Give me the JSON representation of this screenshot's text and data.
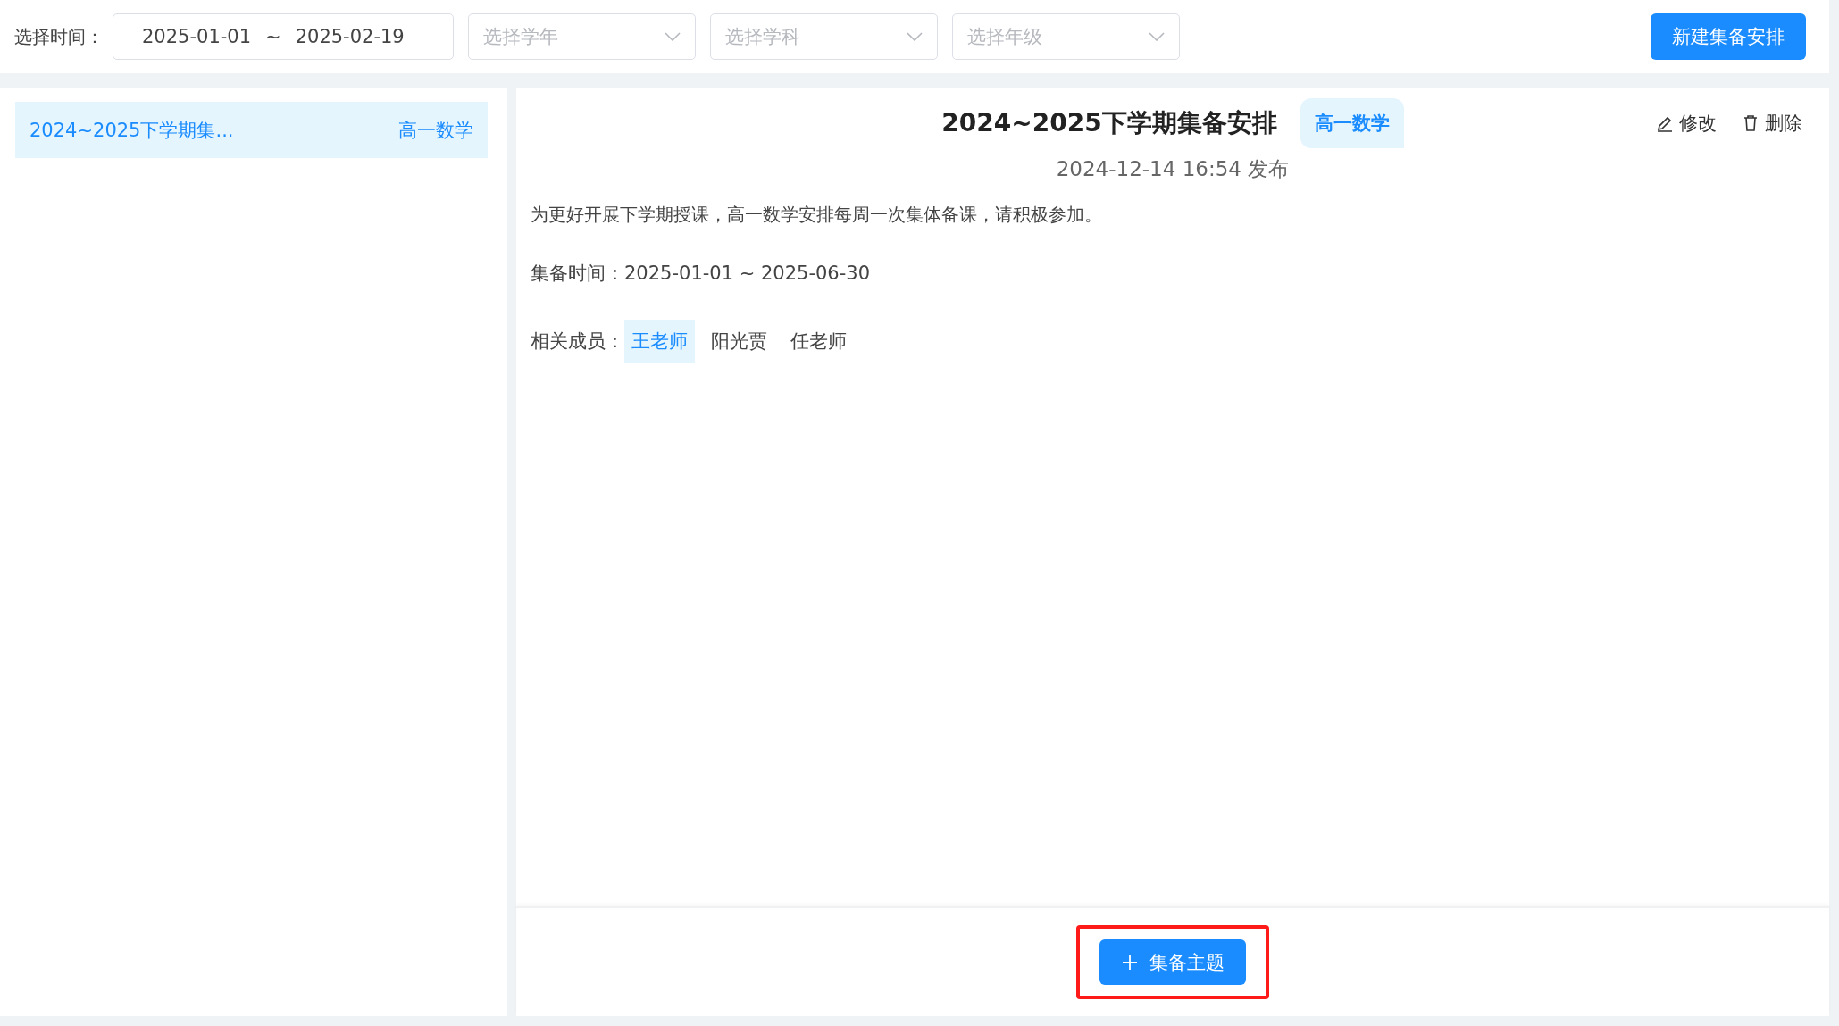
{
  "filter_bar": {
    "time_label": "选择时间：",
    "date_start": "2025-01-01",
    "date_separator": "~",
    "date_end": "2025-02-19",
    "selects": [
      {
        "placeholder": "选择学年"
      },
      {
        "placeholder": "选择学科"
      },
      {
        "placeholder": "选择年级"
      }
    ],
    "new_button": "新建集备安排"
  },
  "list": [
    {
      "title": "2024~2025下学期集...",
      "tag": "高一数学",
      "selected": true
    }
  ],
  "detail": {
    "title": "2024~2025下学期集备安排",
    "tag": "高一数学",
    "edit": "修改",
    "delete": "删除",
    "published": "2024-12-14 16:54 发布",
    "description": "为更好开展下学期授课，高一数学安排每周一次集体备课，请积极参加。",
    "time_label": "集备时间：",
    "time_value": "2025-01-01 ~ 2025-06-30",
    "members_label": "相关成员：",
    "members": [
      {
        "name": "王老师",
        "selected": true
      },
      {
        "name": "阳光贾",
        "selected": false
      },
      {
        "name": "任老师",
        "selected": false
      }
    ],
    "add_topic_button": "集备主题"
  }
}
